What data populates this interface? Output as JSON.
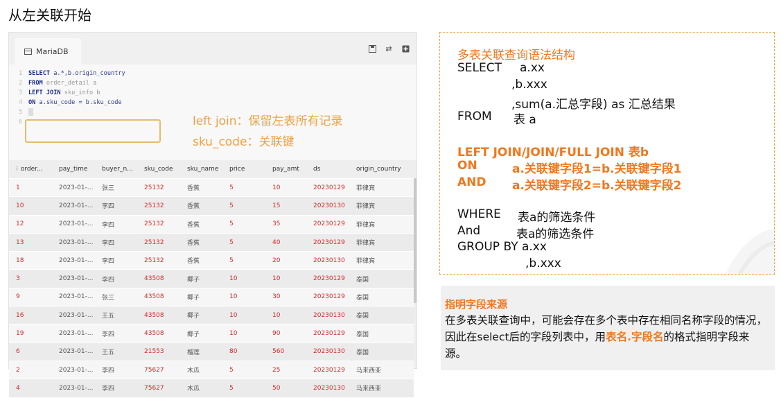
{
  "slide_title": "从左关联开始",
  "app": {
    "tab_label": "MariaDB",
    "toolbar": [
      "save-icon",
      "refresh-icon",
      "add-icon"
    ]
  },
  "editor": {
    "line_numbers": [
      "1",
      "2",
      "3",
      "4",
      "5",
      "6"
    ],
    "lines": [
      "SELECT a.*,b.origin_country",
      "FROM order_detail a",
      "LEFT JOIN sku_info b",
      "ON a.sku_code = b.sku_code",
      "",
      ""
    ],
    "annotation_left_join": "left join：保留左表所有记录",
    "annotation_sku_code": "sku_code：关联键"
  },
  "grid": {
    "columns": [
      "order...",
      "pay_time",
      "buyer_n...",
      "sku_code",
      "sku_name",
      "price",
      "pay_amt",
      "ds",
      "origin_country"
    ],
    "rows": [
      [
        "1",
        "2023-01-...",
        "张三",
        "25132",
        "香蕉",
        "5",
        "10",
        "20230129",
        "菲律宾"
      ],
      [
        "10",
        "2023-01-...",
        "李四",
        "25132",
        "香蕉",
        "5",
        "15",
        "20230130",
        "菲律宾"
      ],
      [
        "12",
        "2023-01-...",
        "李四",
        "25132",
        "香蕉",
        "5",
        "35",
        "20230129",
        "菲律宾"
      ],
      [
        "13",
        "2023-01-...",
        "李四",
        "25132",
        "香蕉",
        "5",
        "40",
        "20230129",
        "菲律宾"
      ],
      [
        "18",
        "2023-01-...",
        "李四",
        "25132",
        "香蕉",
        "5",
        "20",
        "20230130",
        "菲律宾"
      ],
      [
        "3",
        "2023-01-...",
        "李四",
        "43508",
        "椰子",
        "10",
        "10",
        "20230129",
        "泰国"
      ],
      [
        "9",
        "2023-01-...",
        "张三",
        "43508",
        "椰子",
        "10",
        "30",
        "20230129",
        "泰国"
      ],
      [
        "16",
        "2023-01-...",
        "王五",
        "43508",
        "椰子",
        "10",
        "10",
        "20230130",
        "泰国"
      ],
      [
        "19",
        "2023-01-...",
        "李四",
        "43508",
        "椰子",
        "10",
        "90",
        "20230129",
        "泰国"
      ],
      [
        "6",
        "2023-01-...",
        "王五",
        "21553",
        "榴莲",
        "80",
        "560",
        "20230130",
        "泰国"
      ],
      [
        "2",
        "2023-01-...",
        "李四",
        "75627",
        "木瓜",
        "5",
        "25",
        "20230129",
        "马来西亚"
      ],
      [
        "4",
        "2023-01-...",
        "李四",
        "75627",
        "木瓜",
        "5",
        "50",
        "20230130",
        "马来西亚"
      ]
    ]
  },
  "syntax": {
    "title": "多表关联查询语法结构",
    "select": "SELECT",
    "select_col1": "a.xx",
    "select_col2": ",b.xxx",
    "select_col3": ",sum(a.汇总字段) as 汇总结果",
    "from_kw": "FROM",
    "from_table": "表 a",
    "join_line": "LEFT JOIN/JOIN/FULL JOIN 表b",
    "on_kw": "ON",
    "on_cond": "a.关联键字段1=b.关联键字段1",
    "and_kw": "AND",
    "and_cond": "a.关联键字段2=b.关联键字段2",
    "where_kw": "WHERE",
    "where_cond": "表a的筛选条件",
    "and2_kw": "And",
    "and2_cond": "表a的筛选条件",
    "groupby": "GROUP BY a.xx",
    "groupby2": ",b.xxx"
  },
  "note": {
    "title": "指明字段来源",
    "text_before": "在多表关联查询中，可能会存在多个表中存在相同名称字段的情况，因此在select后的字段列表中，用",
    "highlight": "表名.字段名",
    "text_after": "的格式指明字段来源。"
  }
}
